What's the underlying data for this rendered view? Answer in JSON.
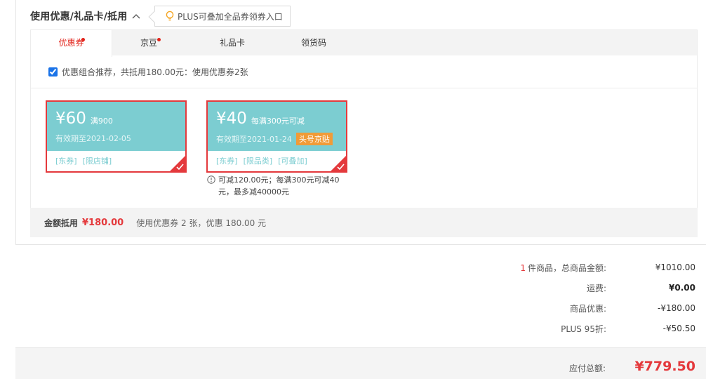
{
  "section": {
    "title": "使用优惠/礼品卡/抵用",
    "tip": "PLUS可叠加全品券领券入口"
  },
  "tabs": [
    {
      "label": "优惠券",
      "active": true,
      "dot": true
    },
    {
      "label": "京豆",
      "active": false,
      "dot": true
    },
    {
      "label": "礼品卡",
      "active": false,
      "dot": false
    },
    {
      "label": "领货码",
      "active": false,
      "dot": false
    }
  ],
  "combo": {
    "checked": true,
    "text": "优惠组合推荐，共抵用180.00元：使用优惠券2张"
  },
  "coupons": [
    {
      "amount": "¥60",
      "condition": "满900",
      "expiry": "有效期至2021-02-05",
      "badge": "",
      "tags": [
        "[东券]",
        "[限店铺]"
      ],
      "selected": true
    },
    {
      "amount": "¥40",
      "condition": "每满300元可减",
      "expiry": "有效期至2021-01-24",
      "badge": "头号京贴",
      "tags": [
        "[东券]",
        "[限品类]",
        "[可叠加]"
      ],
      "selected": true,
      "note": "可减120.00元；每满300元可减40元，最多减40000元"
    }
  ],
  "amount_bar": {
    "label": "金额抵用",
    "value": "¥180.00",
    "desc": "使用优惠券 2 张，优惠 180.00 元"
  },
  "summary": {
    "items_count": "1",
    "items_label": "件商品，总商品金额:",
    "items_total": "¥1010.00",
    "shipping_label": "运费:",
    "shipping_value": "¥0.00",
    "discount_label": "商品优惠:",
    "discount_value": "-¥180.00",
    "plus_label": "PLUS 95折:",
    "plus_value": "-¥50.50",
    "payable_label": "应付总额:",
    "payable_value": "¥779.50"
  },
  "colors": {
    "accent_red": "#e4393c",
    "coupon_teal": "#7ccdd1",
    "badge_orange": "#f19b38"
  }
}
